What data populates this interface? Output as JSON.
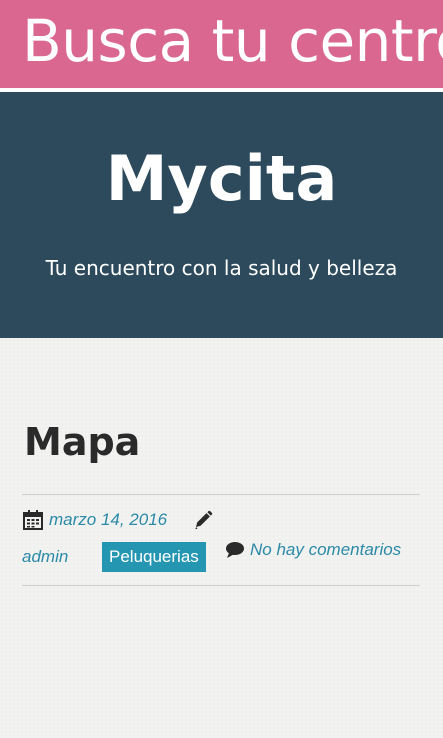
{
  "app_bar": {
    "title": "Busca tu centro"
  },
  "site": {
    "title": "Mycita",
    "tagline": "Tu encuentro con la salud y belleza"
  },
  "post": {
    "title": "Mapa",
    "date": "marzo 14, 2016",
    "author": "admin",
    "category": "Peluquerias",
    "comments": "No hay comentarios"
  },
  "icons": {
    "date": "calendar-icon",
    "author": "pencil-icon",
    "comments": "comment-bubble-icon"
  },
  "colors": {
    "app_bar": "#d9678f",
    "header": "#2c4a5c",
    "link": "#2b8aa7",
    "badge": "#2496b2"
  }
}
